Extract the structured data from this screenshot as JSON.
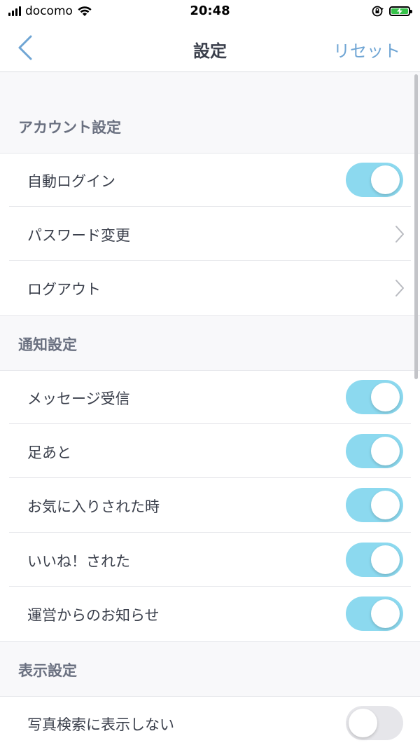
{
  "status_bar": {
    "carrier": "docomo",
    "time": "20:48"
  },
  "nav": {
    "title": "設定",
    "reset_label": "リセット"
  },
  "sections": [
    {
      "title": "アカウント設定",
      "rows": [
        {
          "label": "自動ログイン",
          "type": "toggle",
          "on": true
        },
        {
          "label": "パスワード変更",
          "type": "link"
        },
        {
          "label": "ログアウト",
          "type": "link"
        }
      ]
    },
    {
      "title": "通知設定",
      "rows": [
        {
          "label": "メッセージ受信",
          "type": "toggle",
          "on": true
        },
        {
          "label": "足あと",
          "type": "toggle",
          "on": true
        },
        {
          "label": "お気に入りされた時",
          "type": "toggle",
          "on": true
        },
        {
          "label": "いいね！された",
          "type": "toggle",
          "on": true
        },
        {
          "label": "運営からのお知らせ",
          "type": "toggle",
          "on": true
        }
      ]
    },
    {
      "title": "表示設定",
      "rows": [
        {
          "label": "写真検索に表示しない",
          "type": "toggle",
          "on": false
        }
      ]
    }
  ],
  "colors": {
    "toggle_on": "#8cd9ef",
    "toggle_off": "#e6e6ea",
    "accent": "#6fa5d4",
    "battery": "#36c24a"
  },
  "icons": {
    "back": "chevron-left-icon",
    "disclosure": "chevron-right-icon",
    "wifi": "wifi-icon",
    "orientation_lock": "orientation-lock-icon",
    "battery": "battery-charging-icon"
  }
}
